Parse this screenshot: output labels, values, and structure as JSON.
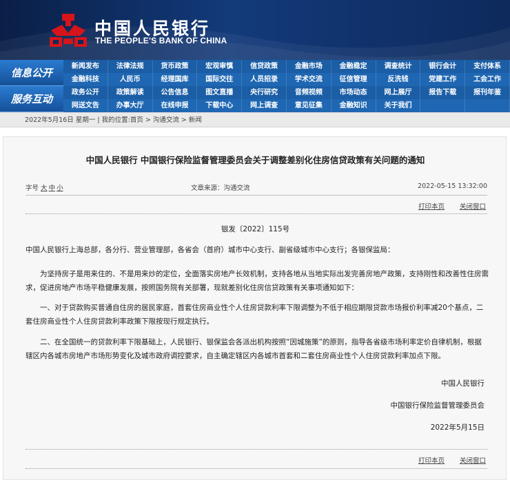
{
  "header": {
    "title_cn": "中国人民银行",
    "title_en": "THE PEOPLE'S BANK OF CHINA",
    "colors": {
      "background": "#0e2a5c",
      "logo_red": "#d7141a"
    }
  },
  "nav": {
    "section1": "信息公开",
    "section2": "服务互动",
    "rows": [
      [
        "新闻发布",
        "法律法规",
        "货币政策",
        "宏观审慎",
        "信贷政策",
        "金融市场",
        "金融稳定",
        "调查统计",
        "银行会计",
        "支付体系"
      ],
      [
        "金融科技",
        "人民币",
        "经理国库",
        "国际交往",
        "人员招录",
        "学术交流",
        "征信管理",
        "反洗钱",
        "党建工作",
        "工会工作"
      ],
      [
        "政务公开",
        "政策解读",
        "公告信息",
        "图文直播",
        "央行研究",
        "音频视频",
        "市场动态",
        "网上展厅",
        "报告下载",
        "报刊年鉴"
      ],
      [
        "网送文告",
        "办事大厅",
        "在线申报",
        "下载中心",
        "网上调查",
        "意见征集",
        "金融知识",
        "关于我们",
        "",
        ""
      ]
    ]
  },
  "breadcrumb": {
    "date": "2022年5月16日 星期一",
    "position_label": "我的位置:",
    "home": "首页",
    "sep": " > ",
    "level1": "沟通交流",
    "level2": "新闻"
  },
  "article": {
    "title": "中国人民银行 中国银行保险监督管理委员会关于调整差别化住房信贷政策有关问题的通知",
    "font_label": "字号",
    "font_large": "大",
    "font_medium": "中",
    "font_small": "小",
    "source_label": "文章来源：",
    "source": "沟通交流",
    "datetime": "2022-05-15 13:32:00",
    "print_label": "打印本页",
    "close_label": "关闭窗口",
    "doc_number": "银发〔2022〕115号",
    "salutation": "中国人民银行上海总部，各分行、营业管理部，各省会（首府）城市中心支行、副省级城市中心支行；各银保监局：",
    "para1": "为坚持房子是用来住的、不是用来炒的定位，全面落实房地产长效机制，支持各地从当地实际出发完善房地产政策，支持刚性和改善性住房需求，促进房地产市场平稳健康发展，按照国务院有关部署，现就差别化住房信贷政策有关事项通知如下：",
    "para2": "一、对于贷款购买普通自住房的居民家庭，首套住房商业性个人住房贷款利率下限调整为不低于相应期限贷款市场报价利率减20个基点，二套住房商业性个人住房贷款利率政策下限按现行规定执行。",
    "para3": "二、在全国统一的贷款利率下限基础上，人民银行、银保监会各派出机构按照“因城施策”的原则，指导各省级市场利率定价自律机制，根据辖区内各城市房地产市场形势变化及城市政府调控要求，自主确定辖区内各城市首套和二套住房商业性个人住房贷款利率加点下限。",
    "sign1": "中国人民银行",
    "sign2": "中国银行保险监督管理委员会",
    "sign_date": "2022年5月15日"
  }
}
